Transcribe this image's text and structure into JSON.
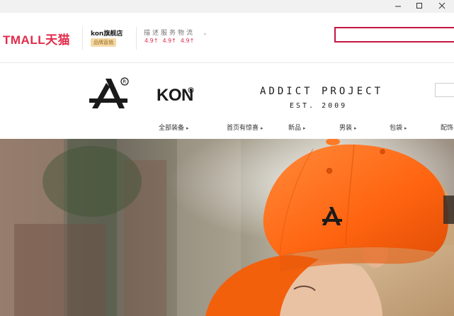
{
  "window": {
    "minimize_icon": "minimize-icon",
    "maximize_icon": "maximize-icon",
    "close_icon": "close-icon"
  },
  "store": {
    "platform_logo": "TMALL天猫",
    "shop_name": "kon旗舰店",
    "shop_badge": "品牌直销",
    "rating_title": "描述服务物流",
    "ratings": [
      "4.9↑",
      "4.9↑",
      "4.9↑"
    ],
    "rating_caret": "⌄"
  },
  "brand": {
    "logo_icon": "kon-a-logo",
    "registered_mark": "®",
    "name": "KON",
    "name_reg": "®",
    "tagline": "ADDICT PROJECT",
    "est": "EST. 2009"
  },
  "nav": {
    "items": [
      {
        "label": "全部装备",
        "arrow": "▸"
      },
      {
        "label": "首页有惊喜",
        "arrow": "▸"
      },
      {
        "label": "新品",
        "arrow": "▸"
      },
      {
        "label": "男装",
        "arrow": "▸"
      },
      {
        "label": "包袋",
        "arrow": "▸"
      },
      {
        "label": "配饰",
        "arrow": ""
      }
    ]
  },
  "hero": {
    "image_icon": "orange-cap-banner",
    "accent": "#ff6a1a"
  },
  "colors": {
    "tmall_red": "#e02b4a",
    "search_border": "#c4163f"
  }
}
